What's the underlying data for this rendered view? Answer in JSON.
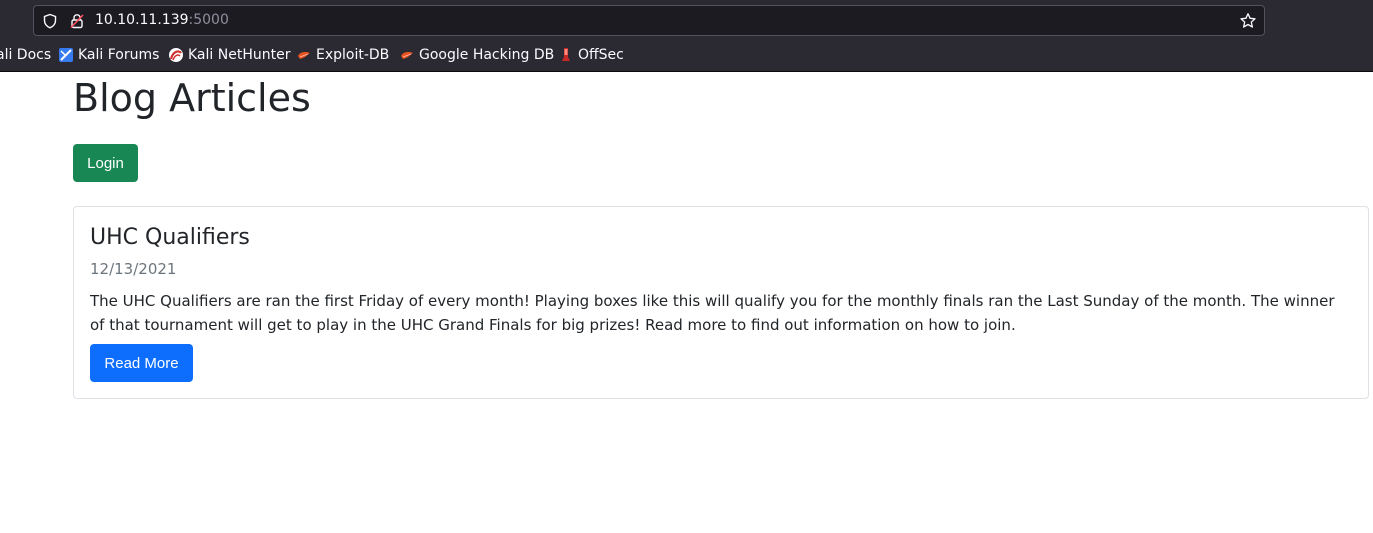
{
  "browser": {
    "url_host": "10.10.11.139",
    "url_port": ":5000",
    "bookmarks": [
      {
        "label": "ali Docs",
        "icon": "kali-docs-icon"
      },
      {
        "label": "Kali Forums",
        "icon": "kali-forums-icon"
      },
      {
        "label": "Kali NetHunter",
        "icon": "kali-nethunter-icon"
      },
      {
        "label": "Exploit-DB",
        "icon": "exploit-db-icon"
      },
      {
        "label": "Google Hacking DB",
        "icon": "google-hacking-db-icon"
      },
      {
        "label": "OffSec",
        "icon": "offsec-icon"
      }
    ]
  },
  "page": {
    "heading": "Blog Articles",
    "login_label": "Login",
    "articles": [
      {
        "title": "UHC Qualifiers",
        "date": "12/13/2021",
        "body": "The UHC Qualifiers are ran the first Friday of every month! Playing boxes like this will qualify you for the monthly finals ran the Last Sunday of the month. The winner of that tournament will get to play in the UHC Grand Finals for big prizes! Read more to find out information on how to join.",
        "button_label": "Read More"
      }
    ]
  },
  "colors": {
    "login_button": "#198754",
    "read_more_button": "#0d6efd",
    "browser_chrome": "#2b2a33"
  }
}
